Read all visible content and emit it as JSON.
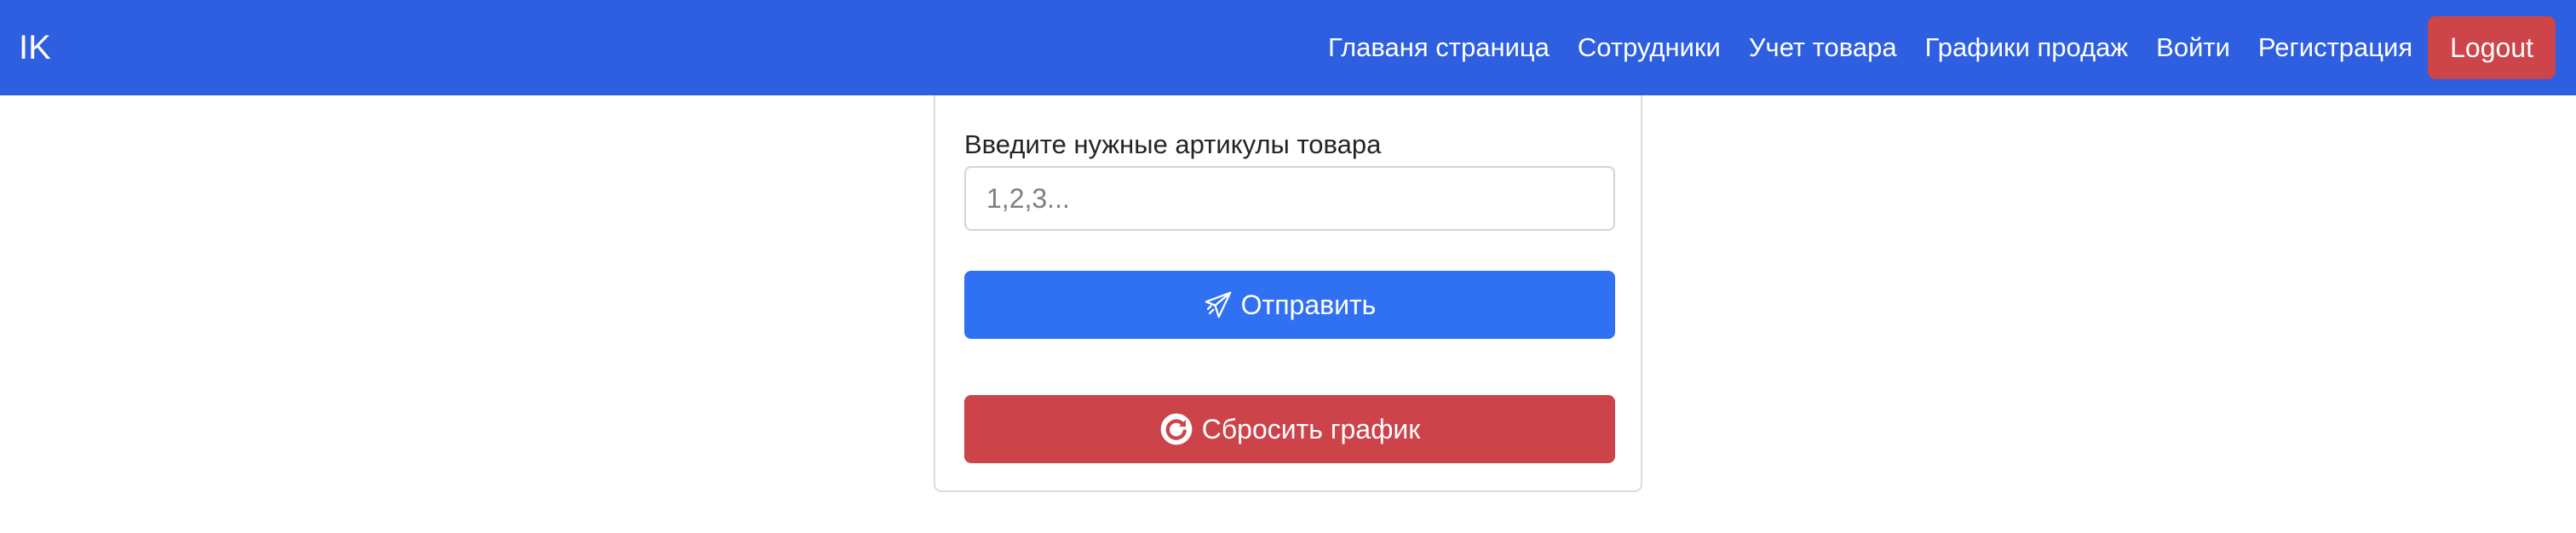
{
  "navbar": {
    "brand": "IK",
    "links": [
      {
        "label": "Главаня страница"
      },
      {
        "label": "Сотрудники"
      },
      {
        "label": "Учет товара"
      },
      {
        "label": "Графики продаж"
      },
      {
        "label": "Войти"
      },
      {
        "label": "Регистрация"
      }
    ],
    "logout_label": "Logout"
  },
  "form": {
    "label": "Введите нужные артикулы товара",
    "input_value": "",
    "input_placeholder": "1,2,3...",
    "send_label": "Отправить",
    "send_icon": "paper-plane-icon",
    "reset_label": "Сбросить график",
    "reset_icon": "refresh-circle-icon"
  },
  "colors": {
    "navbar": "#2d5fe0",
    "primary": "#3070f3",
    "danger": "#cc434a"
  }
}
